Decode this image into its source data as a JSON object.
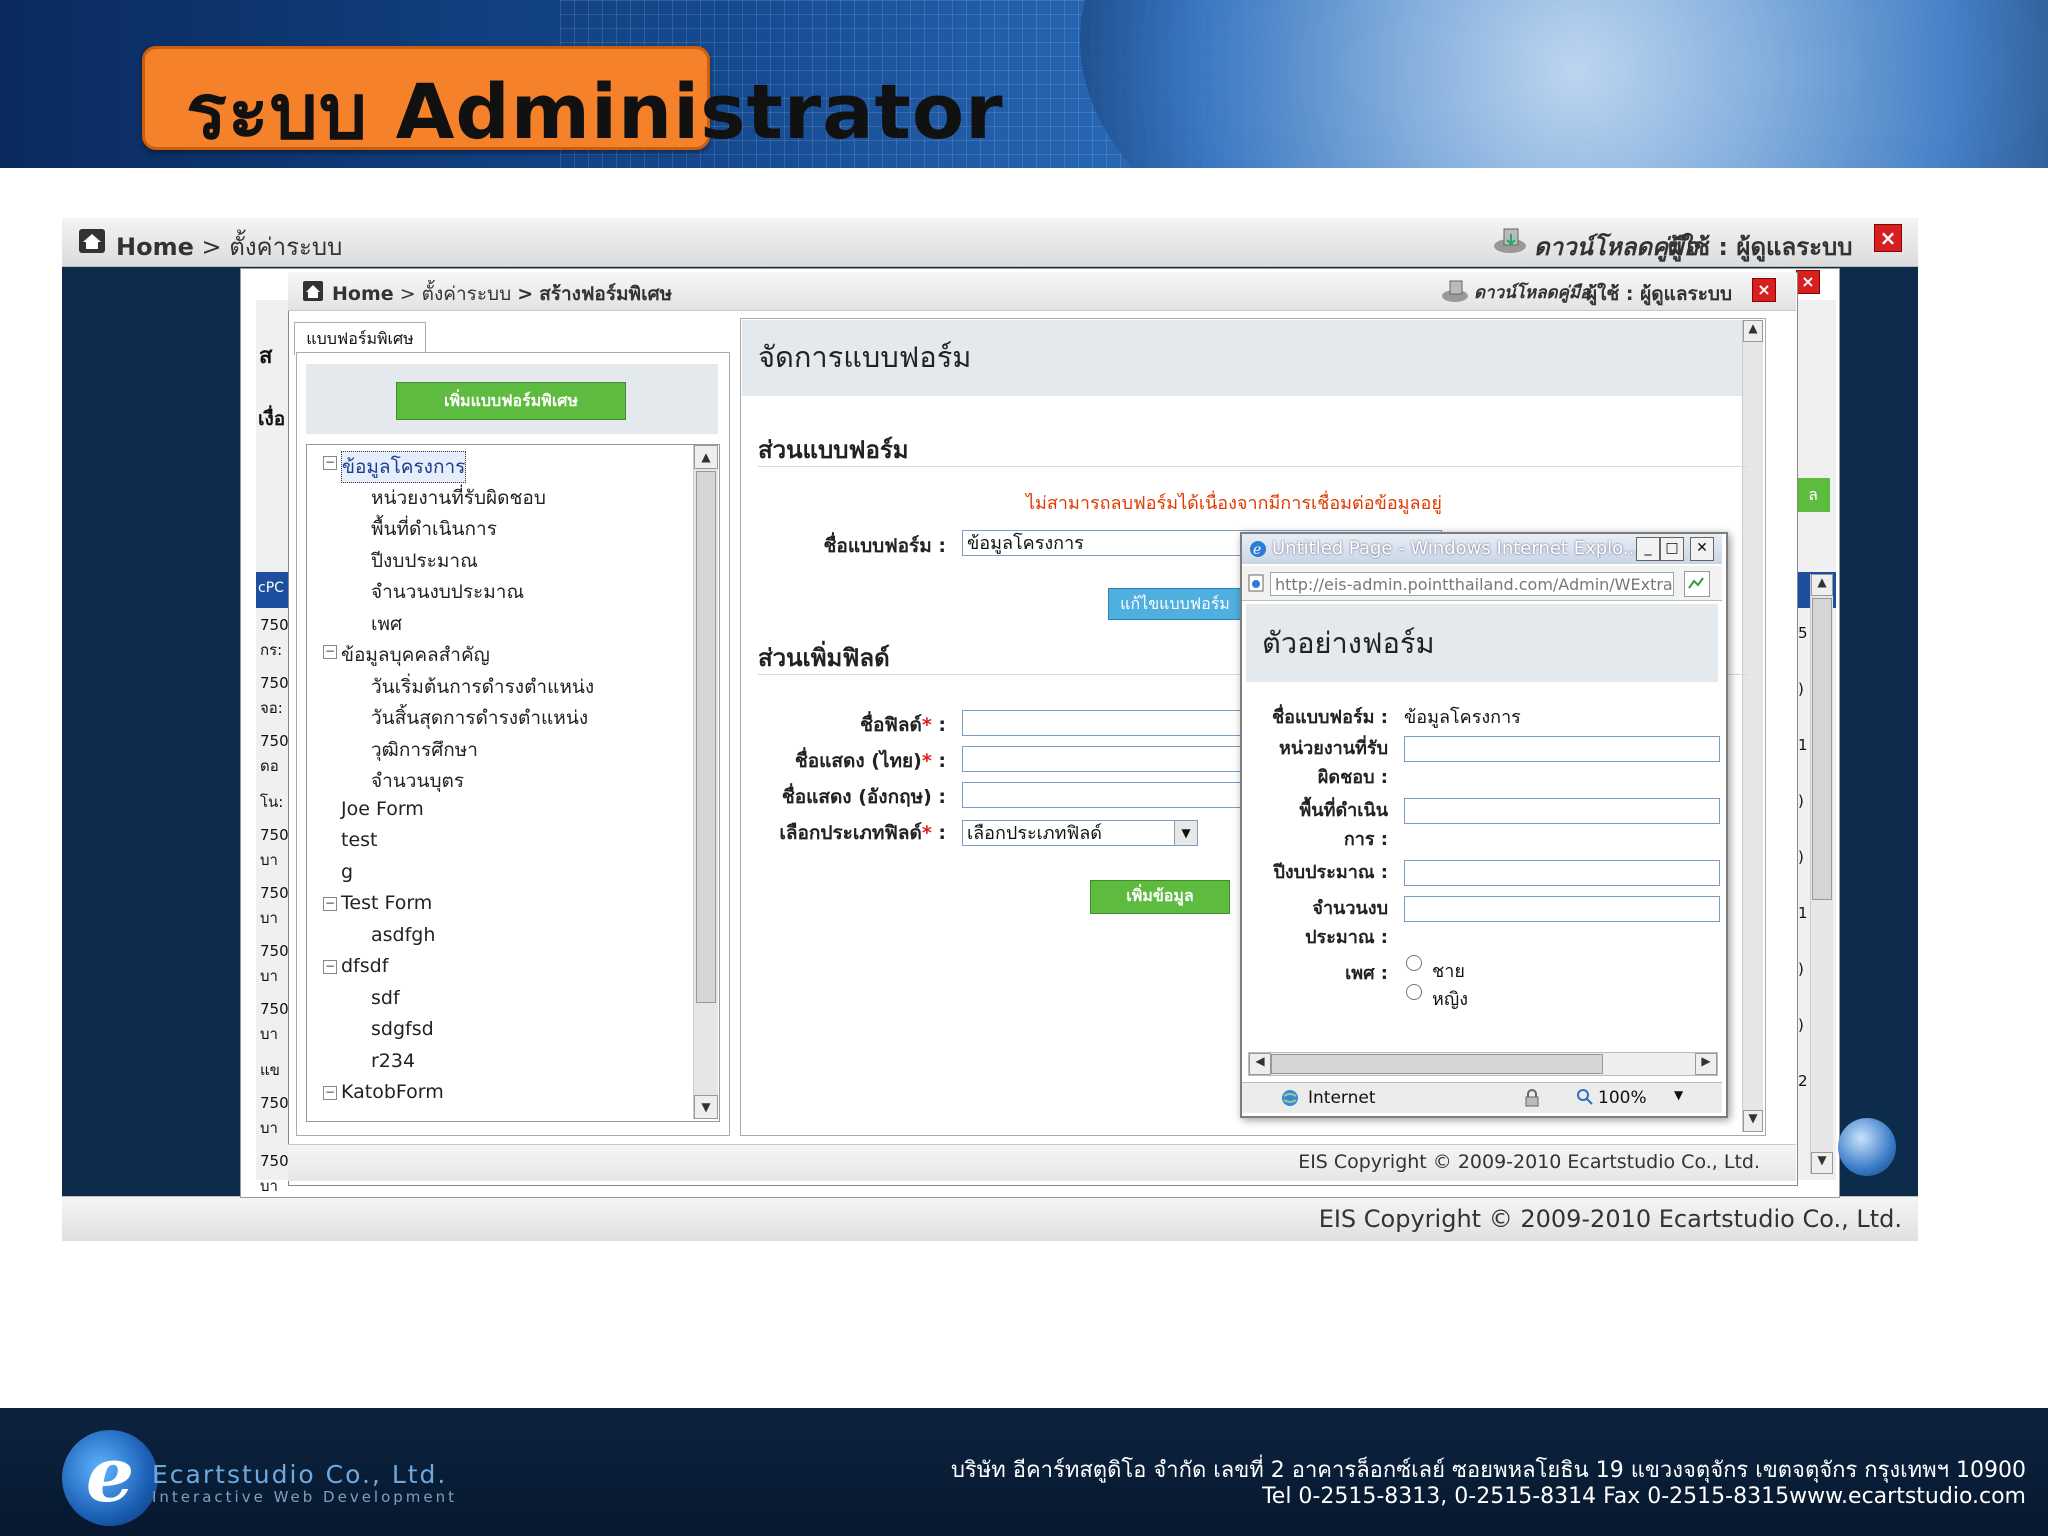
{
  "slide": {
    "title": "ระบบ Administrator"
  },
  "outer": {
    "breadcrumb": {
      "home": "Home",
      "sep": ">",
      "page": "ตั้งค่าระบบ"
    },
    "manual_link": "ดาวน์โหลดคู่มือ",
    "user_label": "ผู้ใช้ : ผู้ดูแลระบบ",
    "close": "×",
    "copyright": "EIS Copyright © 2009-2010 Ecartstudio Co., Ltd.",
    "left_clipped": [
      "ส",
      "เงื่อ",
      "cPC",
      "750",
      "กร:",
      "750",
      "จอ:",
      "750",
      "ดอ",
      "โน:",
      "750",
      "บา",
      "750",
      "บา",
      "750",
      "บา",
      "750",
      "บา",
      "แข",
      "750",
      "บา",
      "750",
      "บา"
    ],
    "right_clipped": [
      "ล",
      "5",
      ")",
      "1",
      ")",
      ")",
      "1",
      ")",
      ")",
      "2"
    ]
  },
  "inner": {
    "breadcrumb": {
      "home": "Home",
      "sep1": ">",
      "settings": "ตั้งค่าระบบ",
      "sep2": ">",
      "page": "สร้างฟอร์มพิเศษ"
    },
    "manual_link": "ดาวน์โหลดคู่มือ",
    "user_label": "ผู้ใช้ : ผู้ดูแลระบบ",
    "close": "×",
    "copyright": "EIS Copyright © 2009-2010 Ecartstudio Co., Ltd."
  },
  "tree_panel": {
    "tab_label": "แบบฟอร์มพิเศษ",
    "add_button": "เพิ่มแบบฟอร์มพิเศษ",
    "nodes": [
      {
        "label": "ข้อมูลโครงการ",
        "selected": true,
        "expander": "⊟"
      },
      {
        "label": "หน่วยงานที่รับผิดชอบ"
      },
      {
        "label": "พื้นที่ดำเนินการ"
      },
      {
        "label": "ปีงบประมาณ"
      },
      {
        "label": "จำนวนงบประมาณ"
      },
      {
        "label": "เพศ"
      },
      {
        "label": "ข้อมูลบุคคลสำคัญ",
        "expander": "⊟"
      },
      {
        "label": "วันเริ่มต้นการดำรงตำแหน่ง"
      },
      {
        "label": "วันสิ้นสุดการดำรงตำแหน่ง"
      },
      {
        "label": "วุฒิการศึกษา"
      },
      {
        "label": "จำนวนบุตร"
      },
      {
        "label": "Joe Form"
      },
      {
        "label": "test"
      },
      {
        "label": "g"
      },
      {
        "label": "Test Form",
        "expander": "⊟"
      },
      {
        "label": "asdfgh"
      },
      {
        "label": "dfsdf",
        "expander": "⊟"
      },
      {
        "label": "sdf"
      },
      {
        "label": "sdgfsd"
      },
      {
        "label": "r234"
      },
      {
        "label": "KatobForm",
        "expander": "⊟"
      }
    ]
  },
  "form_panel": {
    "heading": "จัดการแบบฟอร์ม",
    "section1": "ส่วนแบบฟอร์ม",
    "error": "ไม่สามารถลบฟอร์มได้เนื่องจากมีการเชื่อมต่อข้อมูลอยู่",
    "form_name_label": "ชื่อแบบฟอร์ม :",
    "form_name_value": "ข้อมูลโครงการ",
    "edit_button": "แก้ไขแบบฟอร์ม",
    "section2": "ส่วนเพิ่มฟิลด์",
    "field_name_label": "ชื่อฟิลด์",
    "display_th_label": "ชื่อแสดง (ไทย)",
    "display_en_label": "ชื่อแสดง (อังกฤษ) :",
    "field_type_label": "เลือกประเภทฟิลด์",
    "required_mark": "*",
    "colon": ":",
    "field_type_select": "เลือกประเภทฟิลด์",
    "add_button": "เพิ่มข้อมูล"
  },
  "popup": {
    "title": "Untitled Page - Windows Internet Explo...",
    "url": "http://eis-admin.pointthailand.com/Admin/WExtraFo",
    "heading": "ตัวอย่างฟอร์ม",
    "form_name_label": "ชื่อแบบฟอร์ม :",
    "form_name_value": "ข้อมูลโครงการ",
    "fields": [
      {
        "line1": "หน่วยงานที่รับ",
        "line2": "ผิดชอบ :"
      },
      {
        "line1": "พื้นที่ดำเนิน",
        "line2": "การ :"
      },
      {
        "line1": "ปีงบประมาณ :",
        "line2": ""
      },
      {
        "line1": "จำนวนงบ",
        "line2": "ประมาณ :"
      }
    ],
    "gender_label": "เพศ :",
    "gender_options": [
      "ชาย",
      "หญิง"
    ],
    "status_zone": "Internet",
    "zoom": "100%",
    "win_min": "_",
    "win_max": "□",
    "win_close": "✕"
  },
  "footer": {
    "logo_letter": "e",
    "company": "Ecartstudio Co., Ltd.",
    "tagline": "Interactive Web Development",
    "address": "บริษัท อีคาร์ทสตูดิโอ จำกัด เลขที่ 2 อาคารล็อกซ์เลย์ ซอยพหลโยธิน 19 แขวงจตุจักร เขตจตุจักร กรุงเทพฯ 10900",
    "contact": "Tel 0-2515-8313, 0-2515-8314 Fax 0-2515-8315www.ecartstudio.com"
  },
  "colors": {
    "title_box": "#f5822a",
    "add_green": "#5dbb3f",
    "edit_blue": "#4fb0e0",
    "error": "#e03a00",
    "footer_bg": "#0c2340"
  }
}
